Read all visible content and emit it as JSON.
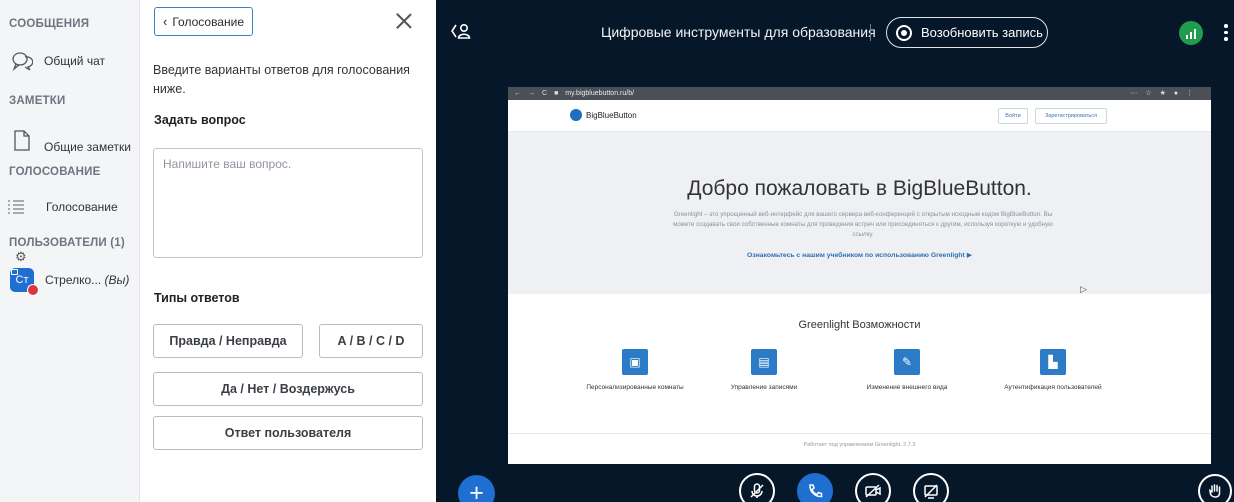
{
  "userlist": {
    "messages_title": "СООБЩЕНИЯ",
    "public_chat": "Общий чат",
    "notes_title": "ЗАМЕТКИ",
    "shared_notes": "Общие заметки",
    "polling_title": "ГОЛОСОВАНИЕ",
    "polling_item": "Голосование",
    "users_title": "ПОЛЬЗОВАТЕЛИ (1)",
    "user": {
      "initials": "Ст",
      "name": "Стрелко...",
      "you": "(Вы)"
    }
  },
  "poll": {
    "back_label": "Голосование",
    "hint": "Введите варианты ответов для голосования ниже.",
    "ask_question": "Задать вопрос",
    "question_placeholder": "Напишите ваш вопрос.",
    "answer_types": "Типы ответов",
    "options": [
      "Правда / Неправда",
      "A / B / C / D",
      "Да / Нет / Воздержусь",
      "Ответ пользователя"
    ]
  },
  "main": {
    "room_title": "Цифровые инструменты для образования",
    "record_label": "Возобновить запись",
    "accent": "#1f6fd1",
    "connection_color": "#1f9d4c"
  },
  "slide": {
    "url": "my.bigbluebutton.ru/b/",
    "logo_text": "BigBlueButton",
    "signin": "Войти",
    "signup": "Зарегистрироваться",
    "welcome": "Добро пожаловать в BigBlueButton.",
    "subtitle": "Greenlight – это упрощенный веб-интерфейс для вашего сервера веб-конференций с открытым исходным кодом BigBlueButton. Вы можете создавать свои собственные комнаты для проведения встреч или присоединяться к другим, используя короткую и удобную ссылку.",
    "tutorial_link": "Ознакомьтесь с нашим учебником по использованию Greenlight",
    "features_title": "Greenlight Возможности",
    "features": [
      "Персонализированные комнаты",
      "Управление записями",
      "Изменение внешнего вида",
      "Аутентификация пользователей"
    ],
    "footer": "Работает под управлением Greenlight. 2.7.3"
  }
}
